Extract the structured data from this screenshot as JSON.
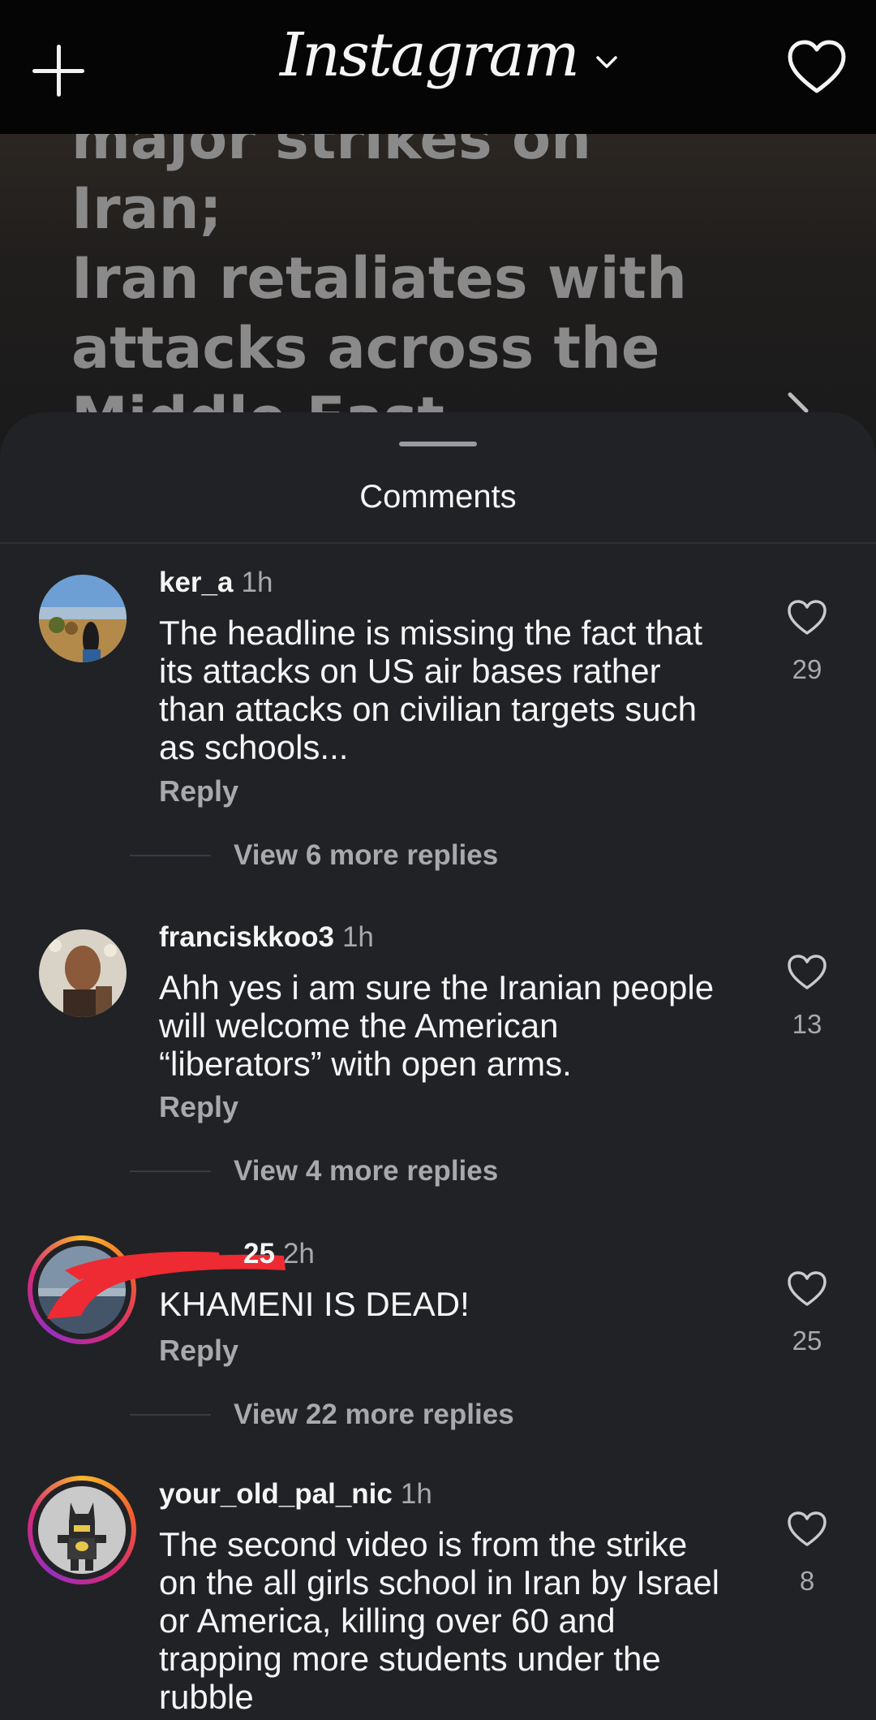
{
  "topbar": {
    "brand": "Instagram"
  },
  "post": {
    "headline_lines": [
      "major strikes on Iran;",
      "Iran retaliates with",
      "attacks across the",
      "Middle East"
    ]
  },
  "sheet": {
    "title": "Comments"
  },
  "comments": [
    {
      "username": "ker_a",
      "time": "1h",
      "text": [
        "The headline is missing the fact that",
        "its attacks on US air bases rather",
        "than attacks on civilian targets such",
        "as schools..."
      ],
      "reply": "Reply",
      "likes": "29",
      "view_more": "View 6 more replies"
    },
    {
      "username": "franciskkoo3",
      "time": "1h",
      "text": [
        "Ahh yes i am sure the Iranian people",
        "will welcome the American",
        "“liberators” with open arms."
      ],
      "reply": "Reply",
      "likes": "13",
      "view_more": "View 4 more replies"
    },
    {
      "username": "25",
      "time": "2h",
      "text": [
        "KHAMENI IS DEAD!"
      ],
      "reply": "Reply",
      "likes": "25",
      "view_more": "View 22 more replies"
    },
    {
      "username": "your_old_pal_nic",
      "time": "1h",
      "text": [
        "The second video is from the strike",
        "on the all girls school in Iran by Israel",
        "or America, killing over 60 and",
        "trapping more students under the",
        "rubble"
      ],
      "likes": "8"
    }
  ],
  "colors": {
    "background": "#212226",
    "text": "#f5f5f5",
    "muted": "#a8a9ad",
    "redaction": "#ee2a33"
  }
}
